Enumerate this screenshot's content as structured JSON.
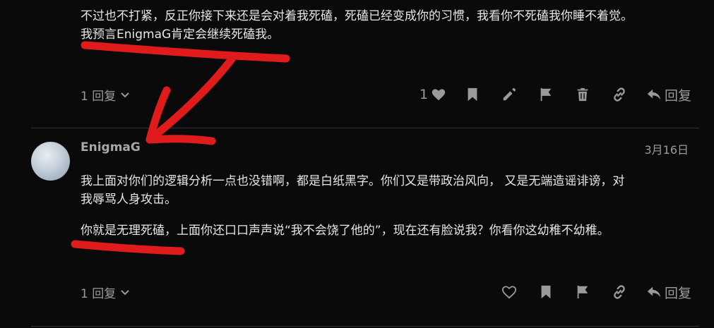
{
  "post1": {
    "text_line1": "不过也不打紧，反正你接下来还是会对着我死磕，死磕已经变成你的习惯，我看你不死磕我你睡不着觉。",
    "text_line2": "我预言EnigmaG肯定会继续死磕我。",
    "reply_count": "1 回复",
    "like_count": "1",
    "reply_button": "回复"
  },
  "post2": {
    "username": "EnigmaG",
    "date": "3月16日",
    "para1_line1": "我上面对你们的逻辑分析一点也没错啊，都是白纸黑字。你们又是带政治风向， 又是无端造谣诽谤，对",
    "para1_line2": "我辱骂人身攻击。",
    "para2": "你就是无理死磕，上面你还口口声声说“我不会饶了他的”，现在还有脸说我？你看你这幼稚不幼稚。",
    "reply_count": "1 回复",
    "reply_button": "回复"
  },
  "annotation_color": "#e01b1b",
  "icons": [
    "heart-icon",
    "bookmark-icon",
    "pencil-icon",
    "flag-icon",
    "trash-icon",
    "link-icon",
    "reply-arrow-icon",
    "chevron-down-icon"
  ]
}
